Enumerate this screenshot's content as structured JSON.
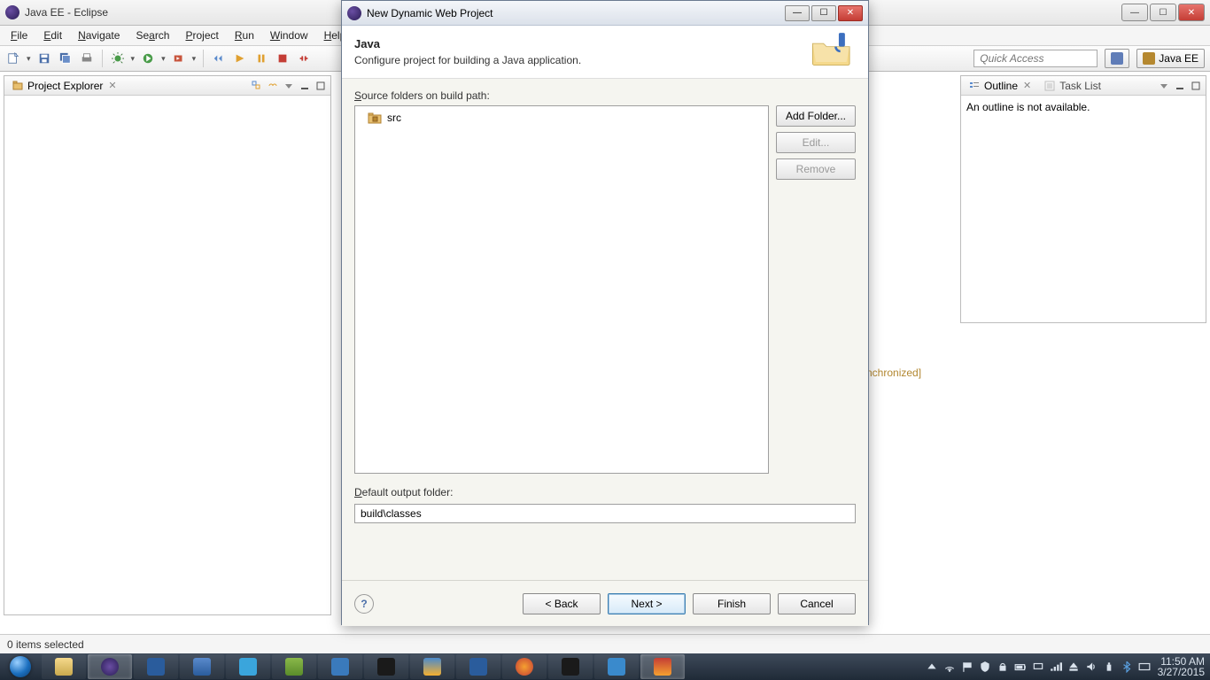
{
  "window": {
    "title": "Java EE - Eclipse",
    "menus": [
      "File",
      "Edit",
      "Navigate",
      "Search",
      "Project",
      "Run",
      "Window",
      "Help"
    ],
    "quick_access_placeholder": "Quick Access",
    "perspective_label": "Java EE"
  },
  "panels": {
    "project_explorer": {
      "title": "Project Explorer"
    },
    "outline": {
      "title": "Outline",
      "task_list_title": "Task List",
      "message": "An outline is not available."
    },
    "sync_text": "nchronized]"
  },
  "statusbar": {
    "text": "0 items selected"
  },
  "dialog": {
    "title": "New Dynamic Web Project",
    "banner_title": "Java",
    "banner_subtitle": "Configure project for building a Java application.",
    "source_label": "Source folders on build path:",
    "source_items": [
      "src"
    ],
    "buttons": {
      "add_folder": "Add Folder...",
      "edit": "Edit...",
      "remove": "Remove"
    },
    "output_label": "Default output folder:",
    "output_value": "build\\classes",
    "wizard": {
      "back": "< Back",
      "next": "Next >",
      "finish": "Finish",
      "cancel": "Cancel"
    },
    "help": "?"
  },
  "taskbar": {
    "time": "11:50 AM",
    "date": "3/27/2015"
  }
}
